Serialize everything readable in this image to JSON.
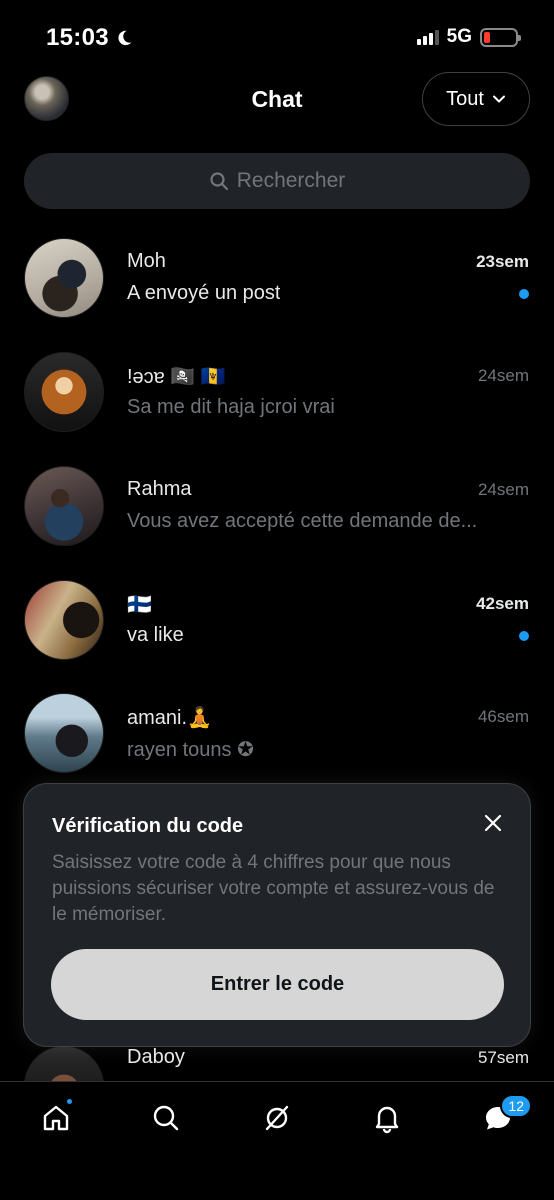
{
  "status_bar": {
    "time": "15:03",
    "network": "5G"
  },
  "header": {
    "title": "Chat",
    "filter_label": "Tout"
  },
  "search": {
    "placeholder": "Rechercher"
  },
  "conversations": [
    {
      "name": "Moh",
      "preview": "A envoyé un post",
      "time": "23sem",
      "unread": true
    },
    {
      "name": "!ǝɔɐ 🏴‍☠️ 🇧🇧",
      "preview": "Sa me dit haja jcroi vrai",
      "time": "24sem",
      "unread": false
    },
    {
      "name": "Rahma",
      "preview": "Vous avez accepté cette demande de...",
      "time": "24sem",
      "unread": false
    },
    {
      "name": "🇫🇮",
      "preview": "va like",
      "time": "42sem",
      "unread": true
    },
    {
      "name": "amani.🧘",
      "preview": "rayen touns ✪",
      "time": "46sem",
      "unread": false
    },
    {
      "name": "Daboy",
      "preview": "",
      "time": "57sem",
      "unread": false
    }
  ],
  "modal": {
    "title": "Vérification du code",
    "body": "Saisissez votre code à 4 chiffres pour que nous puissions sécuriser votre compte et assurez-vous de le mémoriser.",
    "button_label": "Entrer le code"
  },
  "bottom_nav": {
    "items": [
      {
        "icon": "home-icon",
        "has_dot": true
      },
      {
        "icon": "search-icon"
      },
      {
        "icon": "grok-icon"
      },
      {
        "icon": "bell-icon"
      },
      {
        "icon": "messages-icon",
        "badge": "12"
      }
    ]
  },
  "colors": {
    "accent": "#1d9bf0",
    "background": "#000000",
    "muted_text": "#71767b",
    "modal_bg": "#202327"
  }
}
